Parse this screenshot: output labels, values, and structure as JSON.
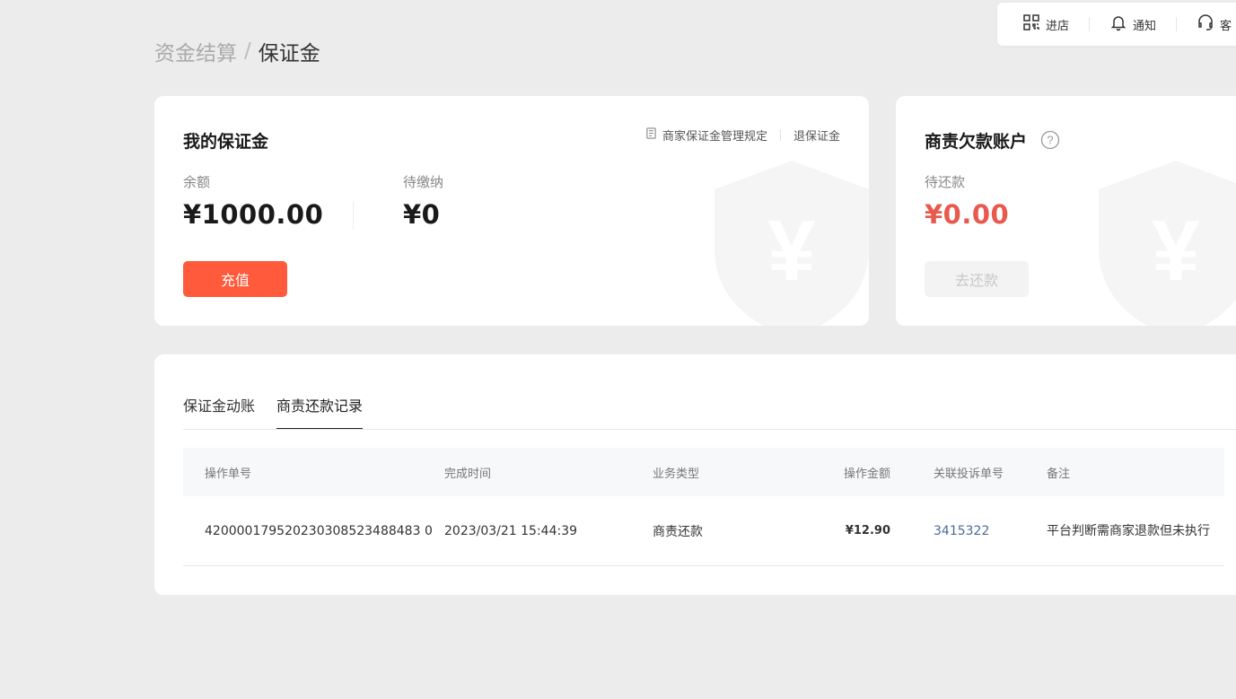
{
  "topbar": {
    "enter_store": "进店",
    "notify": "通知",
    "service": "客"
  },
  "breadcrumb": {
    "parent": "资金结算",
    "separator": "/",
    "current": "保证金"
  },
  "deposit_card": {
    "title": "我的保证金",
    "rules_link": "商家保证金管理规定",
    "refund_link": "退保证金",
    "balance_label": "余额",
    "balance_value": "¥1000.00",
    "pending_label": "待缴纳",
    "pending_value": "¥0",
    "recharge_button": "充值"
  },
  "debt_card": {
    "title": "商责欠款账户",
    "due_label": "待还款",
    "due_value": "¥0.00",
    "repay_button": "去还款"
  },
  "records": {
    "tabs": [
      {
        "label": "保证金动账",
        "active": false
      },
      {
        "label": "商责还款记录",
        "active": true
      }
    ],
    "columns": [
      "操作单号",
      "完成时间",
      "业务类型",
      "操作金额",
      "关联投诉单号",
      "备注"
    ],
    "rows": [
      {
        "order_no": "420000179520230308523488483 0",
        "finished_at": "2023/03/21 15:44:39",
        "biz_type": "商责还款",
        "amount": "¥12.90",
        "complaint_no": "3415322",
        "remark": "平台判断需商家退款但未执行"
      }
    ]
  },
  "colors": {
    "accent": "#ff5a3c",
    "debt_red": "#e85a4f",
    "link_blue": "#4a6b9a",
    "page_bg": "#ececec"
  }
}
